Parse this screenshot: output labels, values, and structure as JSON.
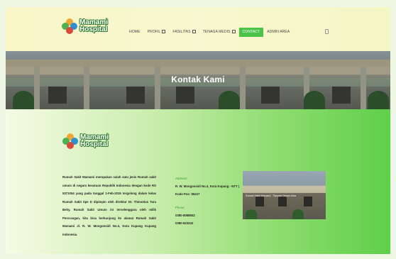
{
  "header": {
    "logo_line1": "Mamami",
    "logo_line2": "Hospital",
    "nav": [
      {
        "label": "HOME"
      },
      {
        "label": "PROFIL"
      },
      {
        "label": "FASILITAS"
      },
      {
        "label": "TENAGA MEDIS"
      },
      {
        "label": "CONTACT"
      },
      {
        "label": "ADMIN AREA"
      }
    ],
    "active_nav": "CONTACT"
  },
  "banner": {
    "title": "Kontak Kami"
  },
  "content": {
    "logo_line1": "Mamami",
    "logo_line2": "Hospital",
    "description": "Rumah Sakit Mamami merupakan salah satu jenis Rumah sakit umum di negara kesatuan Republik Indonesia dengan kode RS 5371054 yang pada tanggal 1-Feb-2015 tergolong dalam kelas Rumah Sakit tipe D dipimpin oleh direktur Dr. Thimotius Tara Behy. Rumah Sakit Umum ini terselenggara oleh milik Perorangan, kita bisa berkunjung ke alamat Rumah Sakit Mamami Jl. R. W. Mongonsidi No.3, Kota Kupang Kupang Indonesia.",
    "address_label": "Address:",
    "address": "R. W. Mongonsidi No.3, Kota Kupang - NTT | Kode Pos: 85227",
    "phone_label": "Phone:",
    "phones": [
      "0380-8088652",
      "0380-823242"
    ],
    "photo_caption": "Rumah Sakit Mamami - Tampak Depan Area"
  },
  "colors": {
    "accent": "#49c449",
    "header_bg": "#f8f6c6",
    "label_green": "#2f9e2f"
  }
}
